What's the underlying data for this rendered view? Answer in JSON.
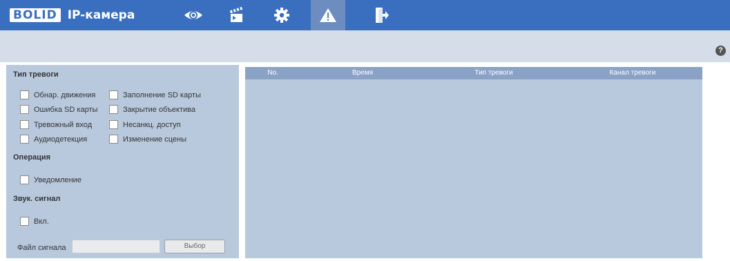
{
  "header": {
    "logo_box": "BOLID",
    "logo_text": "IP-камера",
    "nav": [
      {
        "name": "live-view",
        "icon": "eye-icon"
      },
      {
        "name": "playback",
        "icon": "clapperboard-icon"
      },
      {
        "name": "settings",
        "icon": "gear-icon"
      },
      {
        "name": "alarm",
        "icon": "warning-icon",
        "active": true
      },
      {
        "name": "logout",
        "icon": "exit-door-icon"
      }
    ],
    "colors": {
      "bar": "#3a6fc0",
      "active": "#6d8cc0"
    }
  },
  "toolbar": {
    "help_label": "?"
  },
  "alarm_type": {
    "title": "Тип тревоги",
    "items": [
      {
        "label": "Обнар. движения",
        "checked": false
      },
      {
        "label": "Заполнение SD карты",
        "checked": false
      },
      {
        "label": "Ошибка SD карты",
        "checked": false
      },
      {
        "label": "Закрытие объектива",
        "checked": false
      },
      {
        "label": "Тревожный вход",
        "checked": false
      },
      {
        "label": "Несанкц. доступ",
        "checked": false
      },
      {
        "label": "Аудиодетекция",
        "checked": false
      },
      {
        "label": "Изменение сцены",
        "checked": false
      }
    ]
  },
  "operation": {
    "title": "Операция",
    "items": [
      {
        "label": "Уведомление",
        "checked": false
      }
    ]
  },
  "sound": {
    "title": "Звук. сигнал",
    "enable_label": "Вкл.",
    "file_label": "Файл сигнала",
    "file_value": "",
    "browse_label": "Выбор"
  },
  "table": {
    "columns": [
      "No.",
      "Время",
      "Тип тревоги",
      "Канал тревоги"
    ],
    "rows": []
  }
}
